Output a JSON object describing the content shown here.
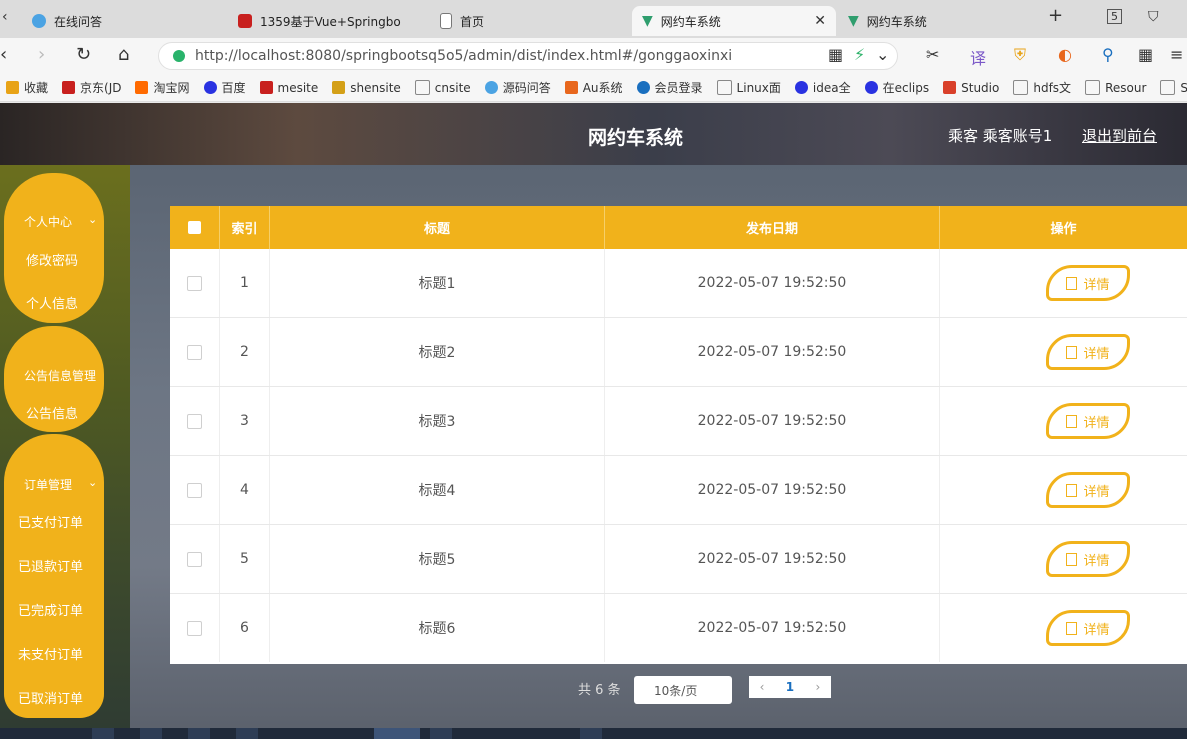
{
  "browser": {
    "tabs": [
      {
        "label": "在线问答",
        "icon": "qa-site-icon"
      },
      {
        "label": "1359基于Vue+Springbo",
        "icon": "site-favicon-red"
      },
      {
        "label": "首页",
        "icon": "page-icon"
      },
      {
        "label": "网约车系统",
        "icon": "vue-icon"
      },
      {
        "label": "网约车系统",
        "icon": "vue-icon"
      }
    ],
    "tab_count_badge": "5",
    "url": "http://localhost:8080/springbootsq5o5/admin/dist/index.html#/gonggaoxinxi",
    "bookmarks": [
      "收藏",
      "京东(JD",
      "淘宝网",
      "百度",
      "mesite",
      "shensite",
      "cnsite",
      "源码问答",
      "Au系统",
      "会员登录",
      "Linux面",
      "idea全",
      "在eclips",
      "Studio",
      "hdfs文",
      "Resour",
      "Sp"
    ]
  },
  "header": {
    "title": "网约车系统",
    "user": "乘客 乘客账号1",
    "logout": "退出到前台"
  },
  "sidebar": {
    "groups": [
      {
        "title": "个人中心",
        "items": [
          "修改密码",
          "个人信息"
        ]
      },
      {
        "title": "公告信息管理",
        "items": [
          "公告信息"
        ]
      },
      {
        "title": "订单管理",
        "items": [
          "已支付订单",
          "已退款订单",
          "已完成订单",
          "未支付订单",
          "已取消订单"
        ]
      }
    ]
  },
  "table": {
    "columns": [
      "索引",
      "标题",
      "发布日期",
      "操作"
    ],
    "rows": [
      {
        "index": "1",
        "title": "标题1",
        "date": "2022-05-07 19:52:50",
        "action": "详情"
      },
      {
        "index": "2",
        "title": "标题2",
        "date": "2022-05-07 19:52:50",
        "action": "详情"
      },
      {
        "index": "3",
        "title": "标题3",
        "date": "2022-05-07 19:52:50",
        "action": "详情"
      },
      {
        "index": "4",
        "title": "标题4",
        "date": "2022-05-07 19:52:50",
        "action": "详情"
      },
      {
        "index": "5",
        "title": "标题5",
        "date": "2022-05-07 19:52:50",
        "action": "详情"
      },
      {
        "index": "6",
        "title": "标题6",
        "date": "2022-05-07 19:52:50",
        "action": "详情"
      }
    ]
  },
  "pagination": {
    "total": "共 6 条",
    "page_size": "10条/页",
    "current_page": "1"
  },
  "colors": {
    "accent": "#f1b21b",
    "link": "#1a6fbf"
  }
}
